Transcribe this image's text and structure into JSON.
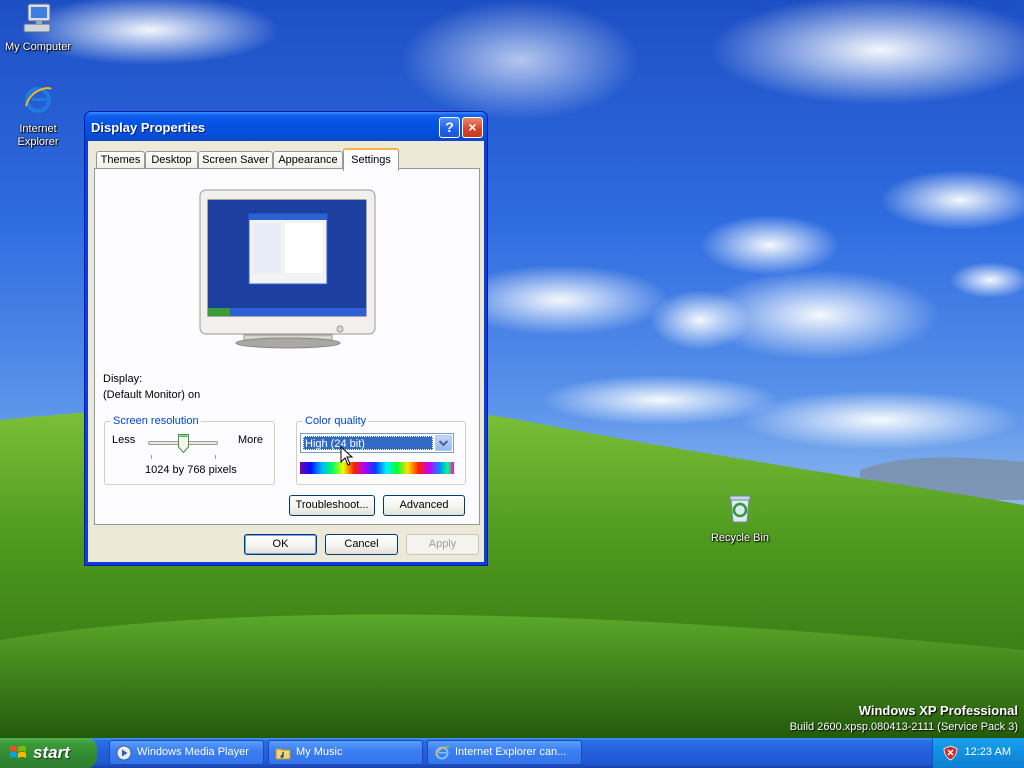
{
  "desktop": {
    "icons": [
      {
        "label": "My Computer",
        "icon": "my-computer-icon"
      },
      {
        "label": "Internet Explorer",
        "icon": "internet-explorer-icon"
      },
      {
        "label": "Recycle Bin",
        "icon": "recycle-bin-icon"
      }
    ],
    "edition": "Windows XP Professional",
    "build": "Build 2600.xpsp.080413-2111 (Service Pack 3)"
  },
  "dialog": {
    "title": "Display Properties",
    "help_label": "?",
    "close_label": "×",
    "tabs": [
      {
        "label": "Themes"
      },
      {
        "label": "Desktop"
      },
      {
        "label": "Screen Saver"
      },
      {
        "label": "Appearance"
      },
      {
        "label": "Settings",
        "active": true
      }
    ],
    "display_label": "Display:",
    "display_value": "(Default Monitor) on",
    "screen_resolution": {
      "legend": "Screen resolution",
      "less": "Less",
      "more": "More",
      "value_text": "1024 by 768 pixels",
      "slider_position": 0.5
    },
    "color_quality": {
      "legend": "Color quality",
      "selected": "High (24 bit)"
    },
    "buttons": {
      "troubleshoot": "Troubleshoot...",
      "advanced": "Advanced",
      "ok": "OK",
      "cancel": "Cancel",
      "apply": "Apply"
    }
  },
  "taskbar": {
    "start_label": "start",
    "tasks": [
      {
        "label": "Windows Media Player",
        "icon": "media-player-icon"
      },
      {
        "label": "My Music",
        "icon": "folder-music-icon"
      },
      {
        "label": "Internet Explorer can...",
        "icon": "internet-explorer-icon"
      }
    ],
    "clock": "12:23 AM"
  },
  "colors": {
    "title_blue": "#0553e2",
    "dialog_face": "#ece9d8",
    "start_green": "#3c9a3b",
    "group_legend": "#0046d5",
    "selection": "#316ac5"
  }
}
